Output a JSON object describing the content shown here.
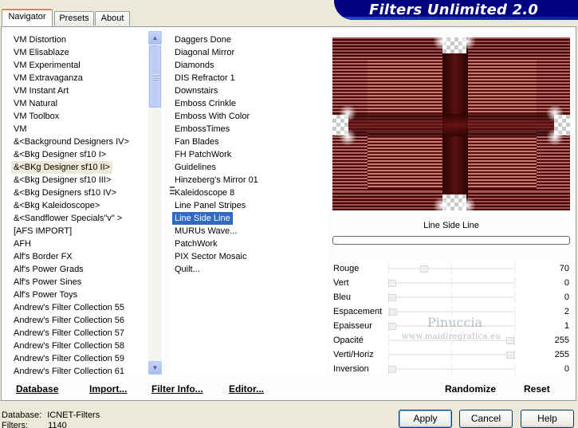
{
  "tabs": [
    {
      "label": "Navigator",
      "active": true
    },
    {
      "label": "Presets",
      "active": false
    },
    {
      "label": "About",
      "active": false
    }
  ],
  "banner": {
    "title": "Filters Unlimited 2.0"
  },
  "categories": [
    {
      "label": "VM Distortion"
    },
    {
      "label": "VM Elisablaze"
    },
    {
      "label": "VM Experimental"
    },
    {
      "label": "VM Extravaganza"
    },
    {
      "label": "VM Instant Art"
    },
    {
      "label": "VM Natural"
    },
    {
      "label": "VM Toolbox"
    },
    {
      "label": "VM"
    },
    {
      "label": "&<Background Designers IV>"
    },
    {
      "label": "&<Bkg Designer sf10 I>"
    },
    {
      "label": "&<BKg Designer sf10 II>",
      "selected": true
    },
    {
      "label": "&<Bkg Designer sf10 III>"
    },
    {
      "label": "&<Bkg Designers sf10 IV>"
    },
    {
      "label": "&<Bkg Kaleidoscope>"
    },
    {
      "label": "&<Sandflower Specials\"v\" >"
    },
    {
      "label": "[AFS IMPORT]"
    },
    {
      "label": "AFH"
    },
    {
      "label": "Alf's Border FX"
    },
    {
      "label": "Alf's Power Grads"
    },
    {
      "label": "Alf's Power Sines"
    },
    {
      "label": "Alf's Power Toys"
    },
    {
      "label": "Andrew's Filter Collection 55"
    },
    {
      "label": "Andrew's Filter Collection 56"
    },
    {
      "label": "Andrew's Filter Collection 57"
    },
    {
      "label": "Andrew's Filter Collection 58"
    },
    {
      "label": "Andrew's Filter Collection 59"
    },
    {
      "label": "Andrew's Filter Collection 61"
    }
  ],
  "filters": [
    {
      "label": "Daggers Done"
    },
    {
      "label": "Diagonal Mirror"
    },
    {
      "label": "Diamonds"
    },
    {
      "label": "DIS Refractor 1"
    },
    {
      "label": "Downstairs"
    },
    {
      "label": "Emboss Crinkle"
    },
    {
      "label": "Emboss With Color"
    },
    {
      "label": "EmbossTimes"
    },
    {
      "label": "Fan Blades"
    },
    {
      "label": "FH PatchWork"
    },
    {
      "label": "Guidelines"
    },
    {
      "label": "Hinzeberg's Mirror 01"
    },
    {
      "label": "Kaleidoscope 8"
    },
    {
      "label": "Line Panel Stripes"
    },
    {
      "label": "Line Side Line",
      "selected": true
    },
    {
      "label": "MURUs Wave..."
    },
    {
      "label": "PatchWork"
    },
    {
      "label": "PIX Sector Mosaic"
    },
    {
      "label": "Quilt..."
    }
  ],
  "preview": {
    "filter_name": "Line Side Line"
  },
  "params": [
    {
      "name": "Rouge",
      "value": "70",
      "level": 0.27
    },
    {
      "name": "Vert",
      "value": "0",
      "level": 0
    },
    {
      "name": "Bleu",
      "value": "0",
      "level": 0
    },
    {
      "name": "Espacement",
      "value": "2",
      "level": 0.01
    },
    {
      "name": "Epaisseur",
      "value": "1",
      "level": 0
    },
    {
      "name": "Opacité",
      "value": "255",
      "level": 1
    },
    {
      "name": "Verti/Horiz",
      "value": "255",
      "level": 1
    },
    {
      "name": "Inversion",
      "value": "0",
      "level": 0
    }
  ],
  "watermark": {
    "name": "Pinuccia",
    "url": "www.maidiregrafica.eu"
  },
  "toolbar": {
    "database": "Database",
    "import": "Import...",
    "filter_info": "Filter Info...",
    "editor": "Editor...",
    "randomize": "Randomize",
    "reset": "Reset"
  },
  "status": {
    "database_label": "Database:",
    "database_value": "ICNET-Filters",
    "filters_label": "Filters:",
    "filters_value": "1140"
  },
  "dialog": {
    "apply": "Apply",
    "cancel": "Cancel",
    "help": "Help"
  },
  "colors": {
    "selection": "#316ac5",
    "banner": "#000080",
    "preview_dark": "#4a0909",
    "preview_light": "#b56863"
  }
}
